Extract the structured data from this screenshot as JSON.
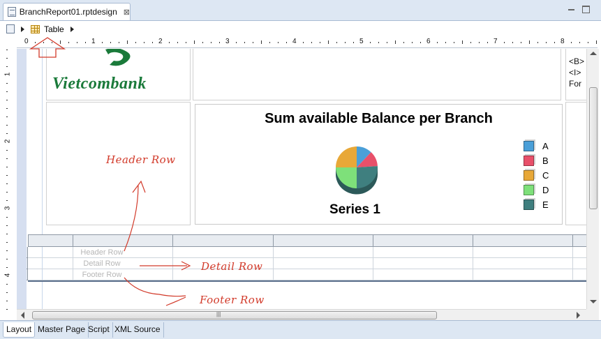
{
  "editor_tab": {
    "title": "BranchReport01.rptdesign",
    "close_glyph": "⊠"
  },
  "breadcrumb": {
    "item": "Table"
  },
  "ruler": {
    "h_labels": [
      "0",
      "1",
      "2",
      "3",
      "4",
      "5",
      "6",
      "7",
      "8"
    ],
    "v_labels": [
      "1",
      "2",
      "3",
      "4"
    ]
  },
  "logo": {
    "text": "Vietcombank",
    "color": "#1a7a3a"
  },
  "side_cell_lines": [
    "<B>",
    "<I>",
    "For"
  ],
  "chart_data": {
    "type": "pie",
    "title": "Sum available Balance per Branch",
    "series_name": "Series 1",
    "legend": [
      "A",
      "B",
      "C",
      "D",
      "E"
    ],
    "legend_position": "right",
    "colors": [
      "#4a9fd8",
      "#e8506a",
      "#e8a838",
      "#7ee07a",
      "#3f7f7f"
    ],
    "values": [
      12,
      12,
      25,
      25,
      26
    ]
  },
  "table": {
    "rows": [
      {
        "label": "Header Row"
      },
      {
        "label": "Detail Row"
      },
      {
        "label": "Footer Row"
      }
    ]
  },
  "annotations": {
    "header": "Header Row",
    "detail": "Detail Row",
    "footer": "Footer Row",
    "color": "#d23a2a"
  },
  "bottom_tabs": [
    "Layout",
    "Master Page",
    "Script",
    "XML Source"
  ]
}
